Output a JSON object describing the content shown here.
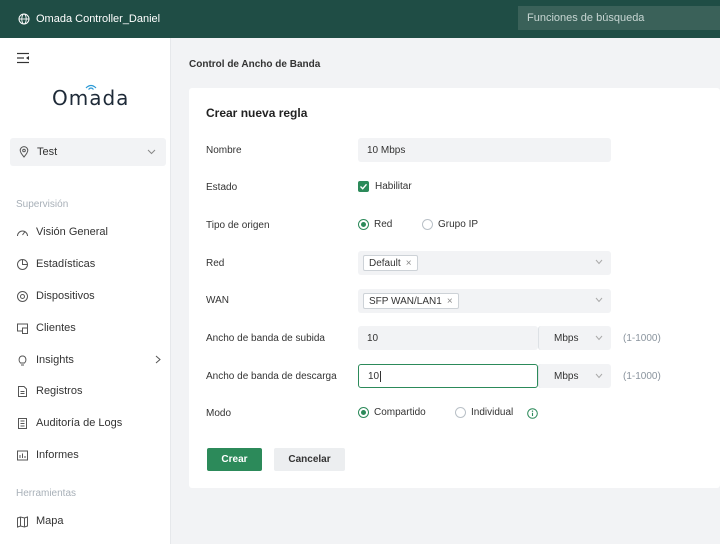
{
  "topbar": {
    "title": "Omada Controller_Daniel",
    "search_placeholder": "Funciones de búsqueda"
  },
  "sidebar": {
    "logo": "Omada",
    "site": "Test",
    "sections": {
      "monitoring": "Supervisión",
      "tools": "Herramientas"
    },
    "items": [
      {
        "label": "Visión General",
        "icon": "speedometer-icon"
      },
      {
        "label": "Estadísticas",
        "icon": "pie-chart-icon"
      },
      {
        "label": "Dispositivos",
        "icon": "devices-icon"
      },
      {
        "label": "Clientes",
        "icon": "clients-icon"
      },
      {
        "label": "Insights",
        "icon": "lightbulb-icon"
      },
      {
        "label": "Registros",
        "icon": "document-icon"
      },
      {
        "label": "Auditoría de Logs",
        "icon": "audit-log-icon"
      },
      {
        "label": "Informes",
        "icon": "report-icon"
      },
      {
        "label": "Mapa",
        "icon": "map-icon"
      }
    ]
  },
  "page": {
    "title": "Control de Ancho de Banda"
  },
  "form": {
    "heading": "Crear nueva regla",
    "name_label": "Nombre",
    "name_value": "10 Mbps",
    "status_label": "Estado",
    "status_checkbox": "Habilitar",
    "status_checked": true,
    "source_type_label": "Tipo de origen",
    "source_type_options": [
      "Red",
      "Grupo IP"
    ],
    "source_type_selected": "Red",
    "network_label": "Red",
    "network_tag": "Default",
    "wan_label": "WAN",
    "wan_tag": "SFP WAN/LAN1",
    "upload_label": "Ancho de banda de subida",
    "upload_value": "10",
    "upload_unit": "Mbps",
    "upload_range": "(1-1000)",
    "download_label": "Ancho de banda de descarga",
    "download_value": "10",
    "download_unit": "Mbps",
    "download_range": "(1-1000)",
    "mode_label": "Modo",
    "mode_options": [
      "Compartido",
      "Individual"
    ],
    "mode_selected": "Compartido",
    "create_button": "Crear",
    "cancel_button": "Cancelar"
  },
  "colors": {
    "topbar": "#1f4d45",
    "accent": "#2c8a5a"
  }
}
